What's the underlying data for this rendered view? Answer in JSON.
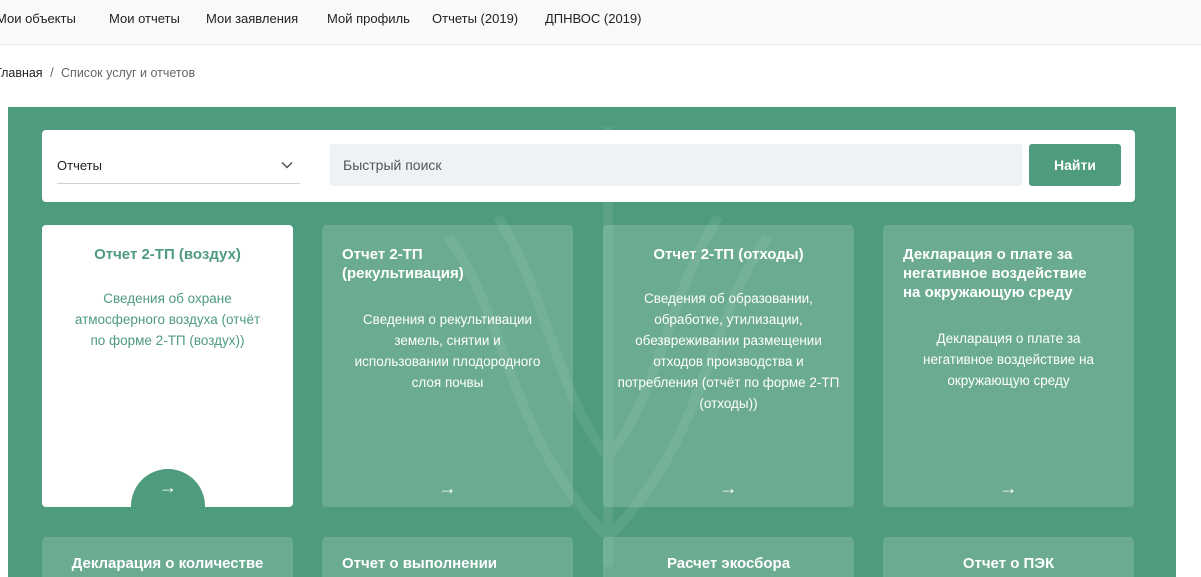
{
  "topnav": {
    "items": [
      "Мои объекты",
      "Мои отчеты",
      "Мои заявления",
      "Мой профиль",
      "Отчеты (2019)",
      "ДПНВОС (2019)"
    ]
  },
  "breadcrumb": {
    "home": "Главная",
    "separator": "/",
    "current": "Список услуг и отчетов"
  },
  "search": {
    "select_value": "Отчеты",
    "placeholder": "Быстрый поиск",
    "button_label": "Найти"
  },
  "cards": [
    {
      "title": "Отчет 2-ТП (воздух)",
      "description": "Сведения об охране атмосферного воздуха (отчёт по форме 2-ТП (воздух))",
      "arrow": "→"
    },
    {
      "title": "Отчет 2-ТП (рекультивация)",
      "description": "Сведения о рекультивации земель, снятии и использовании плодородного слоя почвы",
      "arrow": "→"
    },
    {
      "title": "Отчет 2-ТП (отходы)",
      "description": "Сведения об образовании, обработке, утилизации, обезвреживании размещении отходов производства и потребления (отчёт по форме 2-ТП (отходы))",
      "arrow": "→"
    },
    {
      "title": "Декларация о плате за негативное воздействие на окружающую среду",
      "description": "Декларация о плате за негативное воздействие на окружающую среду",
      "arrow": "→"
    }
  ],
  "cards_row2": [
    {
      "title": "Декларация о количестве"
    },
    {
      "title": "Отчет о выполнении"
    },
    {
      "title": "Расчет экосбора"
    },
    {
      "title": "Отчет о ПЭК"
    }
  ],
  "colors": {
    "brand_green": "#4e9b7d",
    "white": "#ffffff"
  }
}
